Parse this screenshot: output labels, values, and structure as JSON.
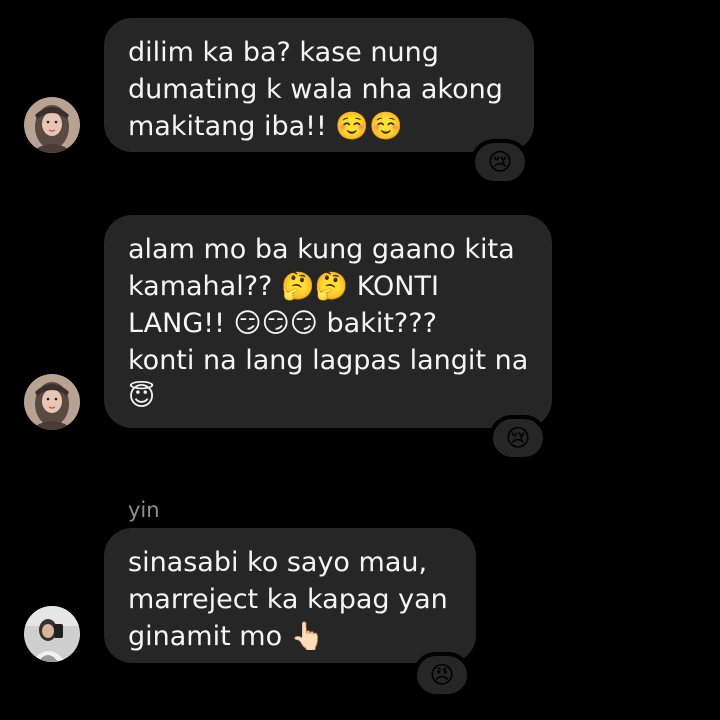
{
  "thread": {
    "messages": [
      {
        "lines": [
          "dilim ka ba? kase nung",
          "dumating k wala nha akong",
          "makitang iba!! ☺️☺️"
        ],
        "reaction": "😢",
        "avatar": "woman-headscarf-avatar"
      },
      {
        "lines": [
          "alam mo ba kung gaano kita",
          "kamahal?? 🤔🤔 KONTI",
          "LANG!! 😏😏😏 bakit???",
          "konti na lang lagpas langit na",
          "😇"
        ],
        "reaction": "😢",
        "avatar": "woman-headscarf-avatar"
      },
      {
        "sender": "yin",
        "lines": [
          "sinasabi ko sayo mau,",
          "marreject ka kapag yan",
          "ginamit mo 👆🏻"
        ],
        "reaction": "😠",
        "avatar": "mirror-selfie-avatar"
      }
    ]
  },
  "colors": {
    "background": "#000000",
    "bubble": "#262626",
    "text": "#f5f5f5",
    "sender_name": "#8e8e8e"
  }
}
